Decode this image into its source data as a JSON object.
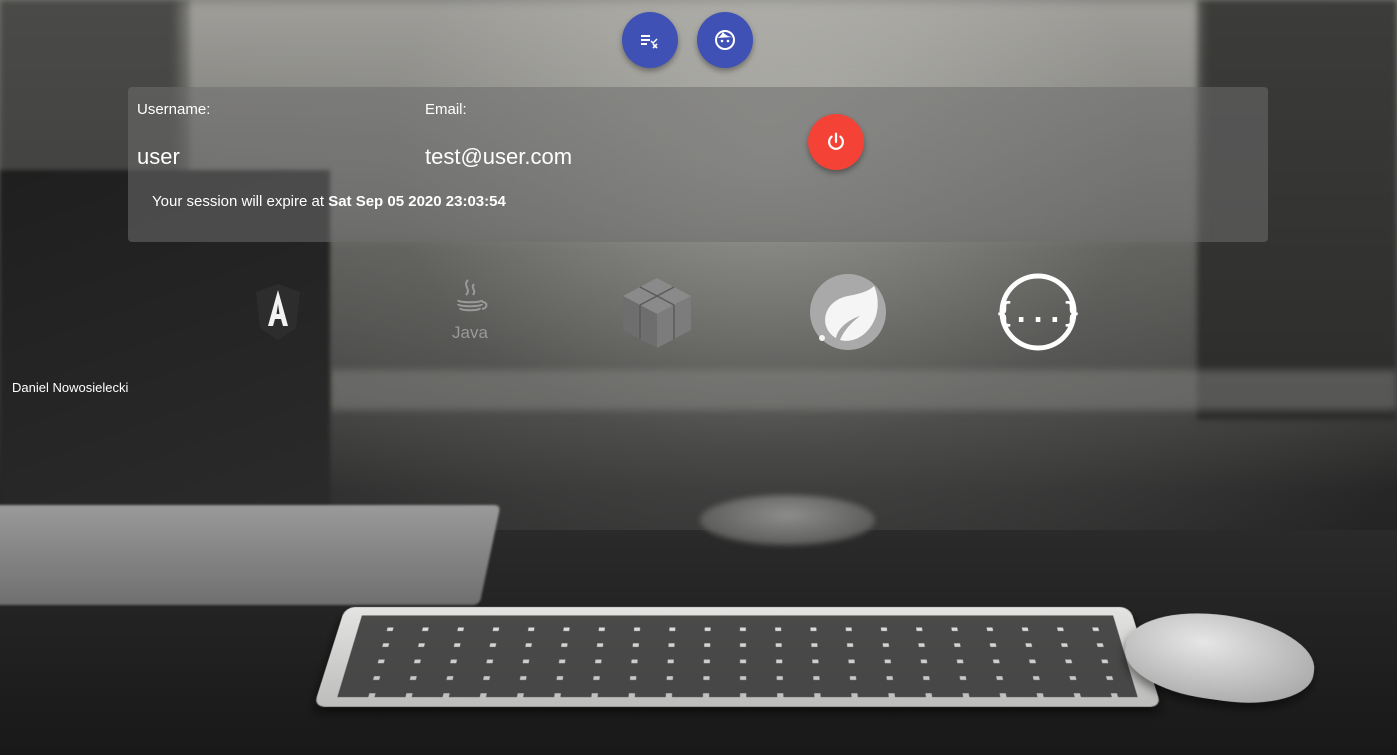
{
  "toolbar": {
    "tasks_icon": "checklist-icon",
    "profile_icon": "face-icon"
  },
  "user_card": {
    "username_label": "Username:",
    "username_value": "user",
    "email_label": "Email:",
    "email_value": "test@user.com",
    "session_prefix": "Your session will expire at ",
    "session_expiry": "Sat Sep 05 2020 23:03:54",
    "logout_icon": "power-icon"
  },
  "tech_logos": {
    "angular": "angular-logo",
    "java": "java-logo",
    "java_text": "Java",
    "cube": "cube-logo",
    "spring": "spring-logo",
    "swagger": "swagger-logo",
    "swagger_text": "{...}"
  },
  "footer": {
    "author": "Daniel Nowosielecki"
  },
  "colors": {
    "primary": "#3f51b5",
    "warn": "#f44336",
    "card_bg": "rgba(110,110,110,0.55)"
  }
}
